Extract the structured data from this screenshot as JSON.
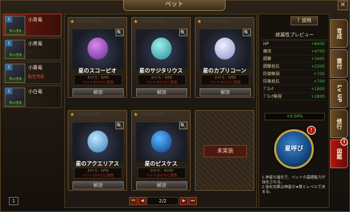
{
  "window": {
    "title": "ペット",
    "close": "✕"
  },
  "left_list": [
    {
      "name": "小青竜",
      "rank": "ランク1",
      "level": "1",
      "sub": ""
    },
    {
      "name": "小黒竜",
      "rank": "ランク3",
      "level": "1",
      "sub": "..."
    },
    {
      "name": "小黄竜",
      "rank": "ランク3",
      "level": "1",
      "sub": "転生可能"
    },
    {
      "name": "小白竜",
      "rank": "ランク3",
      "level": "1",
      "sub": ""
    }
  ],
  "left_page": "1",
  "pets": [
    {
      "name": "星のスコーピオ",
      "shard": "かけら：0/50",
      "note": "ペットかけらに変換",
      "button": "解放"
    },
    {
      "name": "星のサジタリウス",
      "shard": "かけら：0/50",
      "note": "ペットかけらに変換",
      "button": "解放"
    },
    {
      "name": "星のカプリコーン",
      "shard": "かけら：0/50",
      "note": "ペットかけらに変換",
      "button": "解放"
    },
    {
      "name": "星のアクエリアス",
      "shard": "かけら：0/50",
      "note": "ペットかけらに変換",
      "button": "解放"
    },
    {
      "name": "星のピスケス",
      "shard": "かけら：42/50",
      "note": "ペットかけらに変換",
      "button": "解放"
    }
  ],
  "empty_slot": "未実装",
  "pager": {
    "page": "2/2",
    "first": "⏮",
    "prev": "◀",
    "next": "▶",
    "last": "⏭"
  },
  "right": {
    "help": "？説明",
    "title": "綜属性プレビュー",
    "stats": [
      {
        "k": "HP",
        "v": "+8400"
      },
      {
        "k": "魔攻",
        "v": "+4700"
      },
      {
        "k": "闘撃",
        "v": "+3400"
      },
      {
        "k": "闘撃抵抗",
        "v": "+2300"
      },
      {
        "k": "防御無視",
        "v": "+700"
      },
      {
        "k": "防無抵抗",
        "v": "+700"
      },
      {
        "k": "ﾌﾞﾛｯｸ",
        "v": "+1800"
      },
      {
        "k": "ﾌﾞﾛｯｸ無視",
        "v": "+2800"
      }
    ],
    "exp": "+0.00%",
    "exp_fraction": 0.0,
    "summon_button": "星呼び",
    "note": "1.神星の進化で、ペットの基礎能力が強化される。\n2.強化効果は神星の★数とレベルで決まる。"
  },
  "tabs": [
    "育成",
    "霊付",
    "Lv UP",
    "修行",
    "図鑑"
  ],
  "badge": "!"
}
